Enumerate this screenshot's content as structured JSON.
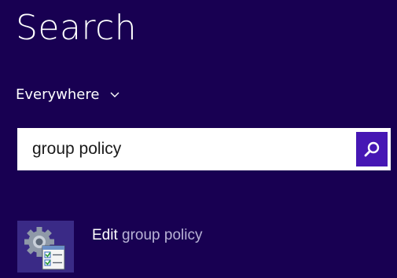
{
  "search_pane": {
    "title": "Search",
    "scope": {
      "label": "Everywhere",
      "icon": "chevron-down-icon"
    },
    "search_box": {
      "value": "group policy",
      "button_icon": "search-icon"
    },
    "results": [
      {
        "icon": "group-policy-editor-icon",
        "prefix": "Edit",
        "match": "group policy"
      }
    ]
  },
  "colors": {
    "background": "#180052",
    "accent": "#4617b4",
    "tile": "#3a2a86",
    "text": "#ffffff",
    "match_text": "#b9b3d6"
  }
}
